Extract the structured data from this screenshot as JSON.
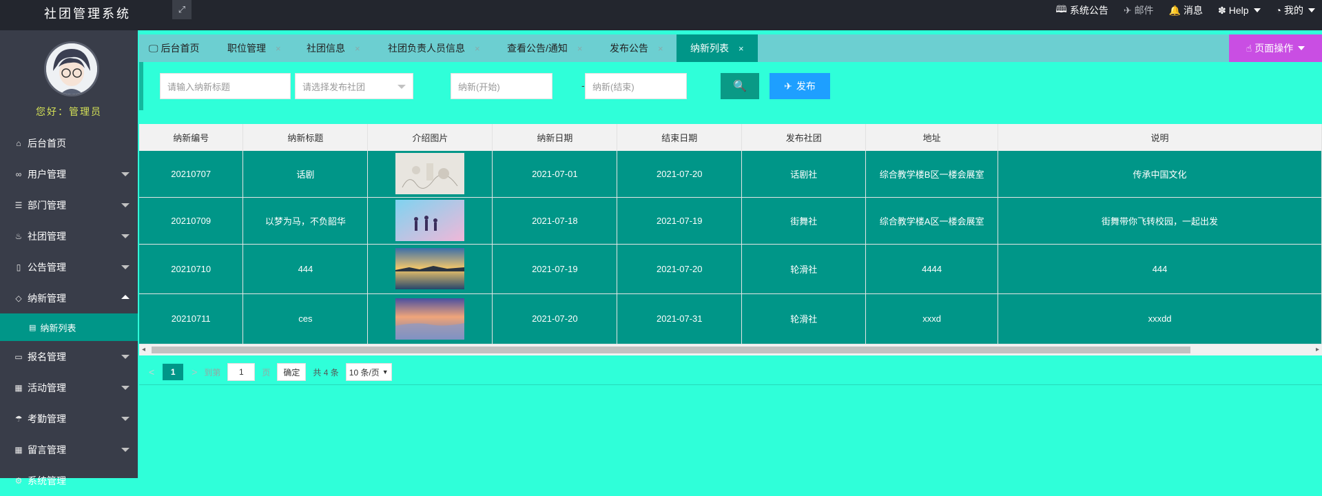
{
  "app": {
    "title": "社团管理系统"
  },
  "topnav": {
    "announcement": "系统公告",
    "mail": "邮件",
    "message": "消息",
    "help": "Help",
    "mine": "我的"
  },
  "sidebar": {
    "greeting": "您好：管理员",
    "items": [
      {
        "label": "后台首页",
        "icon": "home-icon"
      },
      {
        "label": "用户管理",
        "icon": "users-icon"
      },
      {
        "label": "部门管理",
        "icon": "sliders-icon"
      },
      {
        "label": "社团管理",
        "icon": "fire-icon"
      },
      {
        "label": "公告管理",
        "icon": "file-icon"
      },
      {
        "label": "纳新管理",
        "icon": "diamond-icon"
      },
      {
        "label": "纳新列表",
        "icon": "file-icon"
      },
      {
        "label": "报名管理",
        "icon": "card-icon"
      },
      {
        "label": "活动管理",
        "icon": "calendar-icon"
      },
      {
        "label": "考勤管理",
        "icon": "umbrella-icon"
      },
      {
        "label": "留言管理",
        "icon": "calendar-icon"
      },
      {
        "label": "系统管理",
        "icon": "gear-icon"
      }
    ]
  },
  "tabs": [
    "后台首页",
    "职位管理",
    "社团信息",
    "社团负责人员信息",
    "查看公告/通知",
    "发布公告",
    "纳新列表"
  ],
  "page_ops": "页面操作",
  "search": {
    "title_placeholder": "请输入纳新标题",
    "club_placeholder": "请选择发布社团",
    "start_placeholder": "纳新(开始)",
    "end_placeholder": "纳新(结束)",
    "range_separator": "-",
    "publish_label": "发布"
  },
  "table": {
    "headers": [
      "纳新编号",
      "纳新标题",
      "介绍图片",
      "纳新日期",
      "结束日期",
      "发布社团",
      "地址",
      "说明"
    ],
    "rows": [
      [
        "20210707",
        "话剧",
        "",
        "2021-07-01",
        "2021-07-20",
        "话剧社",
        "综合教学楼B区一楼会展室",
        "传承中国文化"
      ],
      [
        "20210709",
        "以梦为马，不负韶华",
        "",
        "2021-07-18",
        "2021-07-19",
        "街舞社",
        "综合教学楼A区一楼会展室",
        "街舞带你飞转校园，一起出发"
      ],
      [
        "20210710",
        "444",
        "",
        "2021-07-19",
        "2021-07-20",
        "轮滑社",
        "4444",
        "444"
      ],
      [
        "20210711",
        "ces",
        "",
        "2021-07-20",
        "2021-07-31",
        "轮滑社",
        "xxxd",
        "xxxdd"
      ]
    ]
  },
  "pager": {
    "current": "1",
    "goto_label": "到第",
    "page_value": "1",
    "page_unit": "页",
    "confirm": "确定",
    "total": "共 4 条",
    "page_size": "10 条/页"
  }
}
